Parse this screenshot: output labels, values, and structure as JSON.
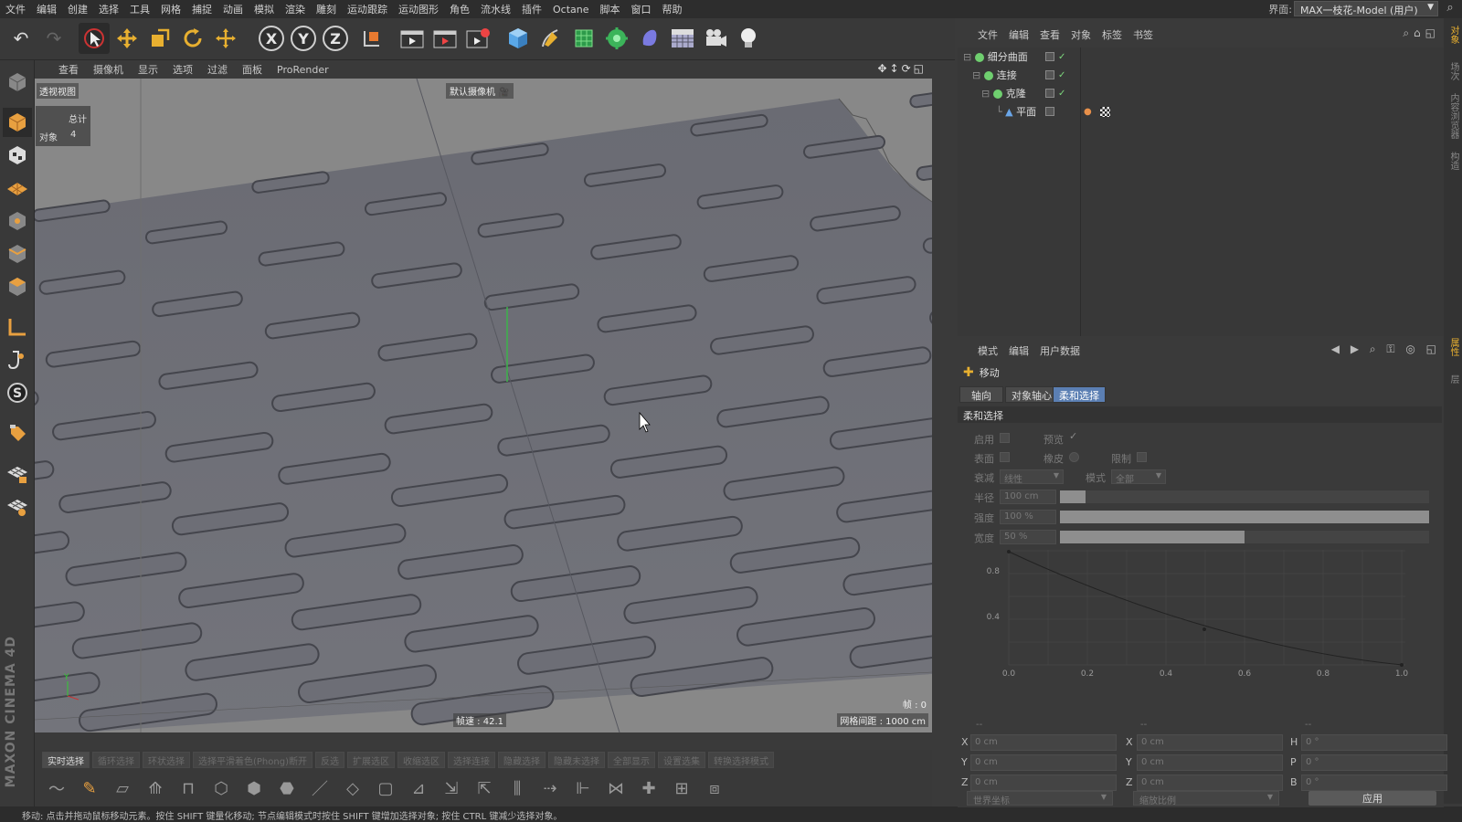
{
  "menu": {
    "items": [
      "文件",
      "编辑",
      "创建",
      "选择",
      "工具",
      "网格",
      "捕捉",
      "动画",
      "模拟",
      "渲染",
      "雕刻",
      "运动跟踪",
      "运动图形",
      "角色",
      "流水线",
      "插件",
      "Octane",
      "脚本",
      "窗口",
      "帮助"
    ],
    "layout_label": "界面:",
    "layout_value": "MAX一枝花-Model (用户)"
  },
  "viewport": {
    "menu": [
      "查看",
      "摄像机",
      "显示",
      "选项",
      "过滤",
      "面板",
      "ProRender"
    ],
    "view_label": "透视视图",
    "camera_label": "默认摄像机",
    "stats": {
      "header": "总计",
      "label": "对象",
      "value": "4"
    },
    "fps": "帧速 : 42.1",
    "frame": "帧 : 0",
    "grid_spacing": "网格间距 : 1000 cm"
  },
  "selection_bar": [
    "实时选择",
    "循环选择",
    "环状选择",
    "选择平滑着色(Phong)断开",
    "反选",
    "扩展选区",
    "收缩选区",
    "选择连接",
    "隐藏选择",
    "隐藏未选择",
    "全部显示",
    "设置选集",
    "转换选择模式"
  ],
  "status": "移动: 点击并拖动鼠标移动元素。按住 SHIFT 键量化移动; 节点编辑模式时按住 SHIFT 键增加选择对象; 按住 CTRL 键减少选择对象。",
  "object_manager": {
    "menu": [
      "文件",
      "编辑",
      "查看",
      "对象",
      "标签",
      "书签"
    ],
    "objects": [
      {
        "name": "细分曲面",
        "color": "#6fcf6f"
      },
      {
        "name": "连接",
        "color": "#6fcf6f"
      },
      {
        "name": "克隆",
        "color": "#6fcf6f"
      },
      {
        "name": "平面",
        "color": "#6aa6e8"
      }
    ]
  },
  "attribute_manager": {
    "menu": [
      "模式",
      "编辑",
      "用户数据"
    ],
    "tool": "移动",
    "tabs": [
      "轴向",
      "对象轴心",
      "柔和选择"
    ],
    "section": "柔和选择",
    "params": {
      "enable": "启用",
      "preview": "预览",
      "surface": "表面",
      "rubber": "橡皮",
      "restrict": "限制",
      "falloff": "衰减",
      "falloff_value": "线性",
      "mode": "模式",
      "mode_value": "全部",
      "radius": "半径",
      "radius_value": "100 cm",
      "radius_fill": 0.07,
      "strength": "强度",
      "strength_value": "100 %",
      "strength_fill": 1.0,
      "width": "宽度",
      "width_value": "50 %",
      "width_fill": 0.5
    },
    "curve": {
      "x_ticks": [
        "0.0",
        "0.2",
        "0.4",
        "0.6",
        "0.8",
        "1.0"
      ],
      "y_ticks": [
        "0.4",
        "0.8"
      ]
    }
  },
  "coordinates": {
    "headers": [
      "--",
      "--",
      "--"
    ],
    "rows": [
      {
        "a": "X",
        "av": "0 cm",
        "b": "X",
        "bv": "0 cm",
        "c": "H",
        "cv": "0 °"
      },
      {
        "a": "Y",
        "av": "0 cm",
        "b": "Y",
        "bv": "0 cm",
        "c": "P",
        "cv": "0 °"
      },
      {
        "a": "Z",
        "av": "0 cm",
        "b": "Z",
        "bv": "0 cm",
        "c": "B",
        "cv": "0 °"
      }
    ],
    "space": "世界坐标",
    "scale": "缩放比例",
    "apply": "应用"
  },
  "right_tabs": [
    "对象",
    "场次",
    "内容浏览器",
    "构造",
    "属性",
    "层"
  ],
  "brand": "MAXON CINEMA 4D"
}
